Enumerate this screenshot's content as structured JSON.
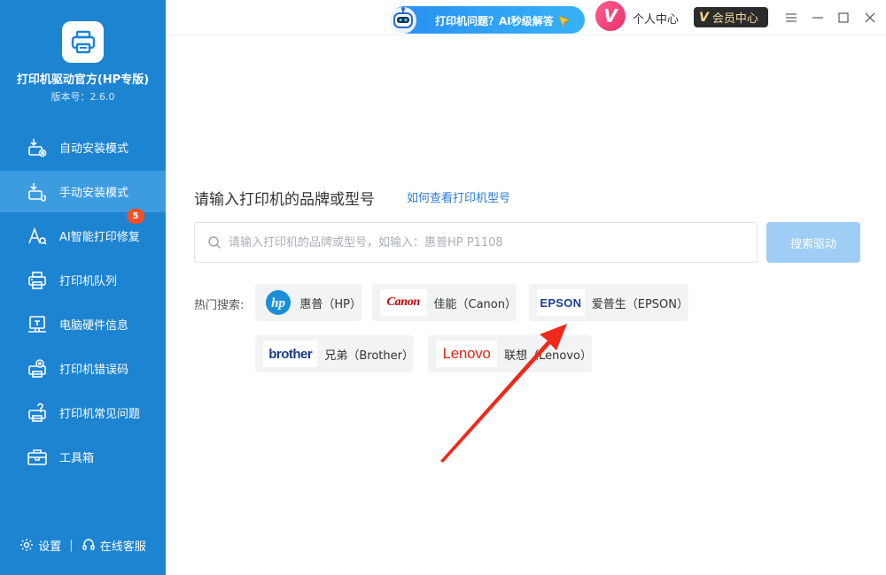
{
  "app": {
    "title": "打印机驱动官方(HP专版)",
    "version": "版本号：2.6.0"
  },
  "sidebar": {
    "items": [
      {
        "label": "自动安装模式",
        "icon": "auto-install-icon"
      },
      {
        "label": "手动安装模式",
        "icon": "manual-install-icon",
        "active": true
      },
      {
        "label": "AI智能打印修复",
        "icon": "ai-repair-icon",
        "badge": "5"
      },
      {
        "label": "打印机队列",
        "icon": "printer-queue-icon"
      },
      {
        "label": "电脑硬件信息",
        "icon": "hardware-info-icon"
      },
      {
        "label": "打印机错误码",
        "icon": "error-code-icon"
      },
      {
        "label": "打印机常见问题",
        "icon": "faq-icon"
      },
      {
        "label": "工具箱",
        "icon": "toolbox-icon"
      }
    ],
    "footer": {
      "settings": "设置",
      "separator": "|",
      "support": "在线客服"
    }
  },
  "topbar": {
    "ai_button": "打印机问题？AI秒级解答",
    "profile": "个人中心",
    "member_v": "V",
    "member": "会员中心"
  },
  "main": {
    "heading": "请输入打印机的品牌或型号",
    "help_link": "如何查看打印机型号",
    "search": {
      "placeholder": "请输入打印机的品牌或型号，如输入：惠普HP P1108",
      "value": ""
    },
    "search_button": "搜索驱动",
    "hot_label": "热门搜索:",
    "brands": [
      {
        "logo": "hp",
        "name": "惠普（HP）"
      },
      {
        "logo": "Canon",
        "name": "佳能（Canon）"
      },
      {
        "logo": "EPSON",
        "name": "爱普生（EPSON）"
      },
      {
        "logo": "brother",
        "name": "兄弟（Brother）"
      },
      {
        "logo": "Lenovo",
        "name": "联想（Lenovo）"
      }
    ]
  },
  "colors": {
    "sidebar": "#1d84d2",
    "sidebar_active": "#3d9be0",
    "badge": "#f04f27",
    "link": "#2b7bd6",
    "search_button": "#9fcdf6",
    "arrow": "#ee2a1b"
  }
}
